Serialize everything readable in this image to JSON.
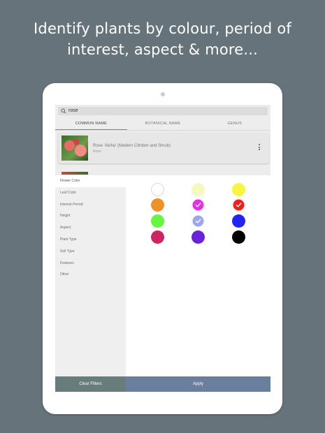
{
  "headline": {
    "line1": "Identify plants by colour, period of",
    "line2": "interest, aspect & more..."
  },
  "search": {
    "value": "rose"
  },
  "tabs": [
    {
      "label": "COMMON NAME",
      "active": true
    },
    {
      "label": "BOTANICAL NAME",
      "active": false
    },
    {
      "label": "GENUS",
      "active": false
    }
  ],
  "result": {
    "title": "Rose 'Aloha' (Modern Climber and Shrub)",
    "subtitle": "Rosa"
  },
  "filters": [
    {
      "label": "Flower Color",
      "active": true
    },
    {
      "label": "Leaf Color",
      "active": false
    },
    {
      "label": "Interest Period",
      "active": false
    },
    {
      "label": "Height",
      "active": false
    },
    {
      "label": "Aspect",
      "active": false
    },
    {
      "label": "Plant Type",
      "active": false
    },
    {
      "label": "Soil Type",
      "active": false
    },
    {
      "label": "Features",
      "active": false
    },
    {
      "label": "Other",
      "active": false
    }
  ],
  "colors": [
    {
      "name": "white",
      "hex": "#ffffff",
      "selected": false
    },
    {
      "name": "cream",
      "hex": "#f7f7c2",
      "selected": false
    },
    {
      "name": "yellow",
      "hex": "#f5f542",
      "selected": false
    },
    {
      "name": "orange",
      "hex": "#f0902a",
      "selected": false
    },
    {
      "name": "magenta",
      "hex": "#dc35e0",
      "selected": true
    },
    {
      "name": "red",
      "hex": "#e8231c",
      "selected": true
    },
    {
      "name": "green",
      "hex": "#66f540",
      "selected": false
    },
    {
      "name": "lavender",
      "hex": "#9ea6ea",
      "selected": true
    },
    {
      "name": "blue",
      "hex": "#2424f2",
      "selected": false
    },
    {
      "name": "crimson",
      "hex": "#cc2563",
      "selected": false
    },
    {
      "name": "purple",
      "hex": "#6a22d6",
      "selected": false
    },
    {
      "name": "black",
      "hex": "#000000",
      "selected": false
    }
  ],
  "buttons": {
    "clear": "Clear Filters",
    "apply": "Apply"
  }
}
